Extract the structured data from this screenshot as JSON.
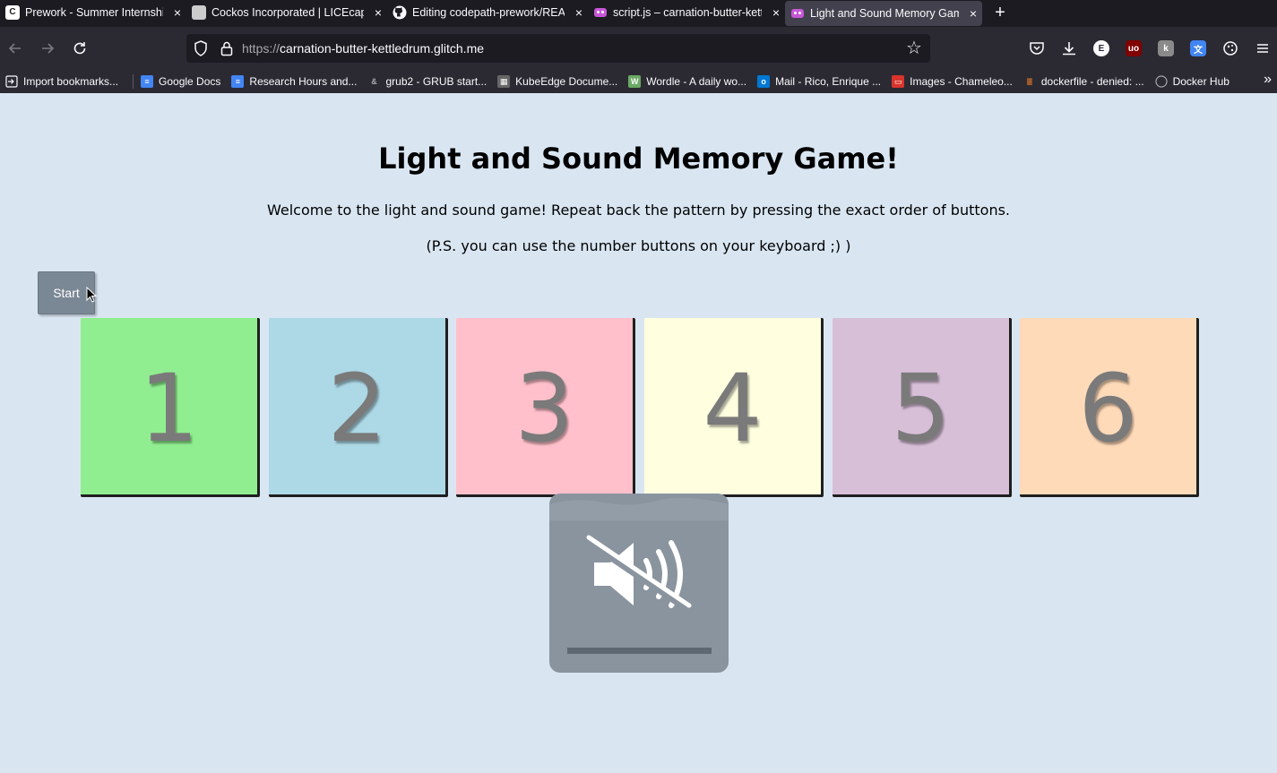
{
  "browser": {
    "tabs": [
      {
        "title": "Prework - Summer Internship for",
        "fav_color": "#ffffff",
        "fav_text": "C",
        "fav_fg": "#1c1b22"
      },
      {
        "title": "Cockos Incorporated | LICEcap",
        "fav_color": "#cccccc",
        "fav_text": "",
        "fav_fg": "#000000"
      },
      {
        "title": "Editing codepath-prework/READ",
        "fav_color": "#1c1b22",
        "fav_text": "",
        "fav_fg": "#ffffff"
      },
      {
        "title": "script.js – carnation-butter-kettl",
        "fav_color": "#c857d8",
        "fav_text": "",
        "fav_fg": "#ffffff"
      },
      {
        "title": "Light and Sound Memory Game!",
        "fav_color": "#c857d8",
        "fav_text": "",
        "fav_fg": "#ffffff"
      }
    ],
    "url_prefix": "https://",
    "url_host": "carnation-butter-kettledrum.glitch.me",
    "bookmarks": [
      {
        "label": "Import bookmarks...",
        "color": "#2b2a33"
      },
      {
        "label": "Google Docs",
        "color": "#4285f4"
      },
      {
        "label": "Research Hours and...",
        "color": "#4285f4"
      },
      {
        "label": "grub2 - GRUB start...",
        "color": "#2b2a33"
      },
      {
        "label": "KubeEdge Docume...",
        "color": "#666666"
      },
      {
        "label": "Wordle - A daily wo...",
        "color": "#6aaa64"
      },
      {
        "label": "Mail - Rico, Enrique ...",
        "color": "#0078d4"
      },
      {
        "label": "Images - Chameleo...",
        "color": "#d9342b"
      },
      {
        "label": "dockerfile - denied: ...",
        "color": "#f48024"
      },
      {
        "label": "Docker Hub",
        "color": "#2b2a33"
      }
    ]
  },
  "page": {
    "title": "Light and Sound Memory Game!",
    "intro": "Welcome to the light and sound game! Repeat back the pattern by pressing the exact order of buttons.",
    "hint": "(P.S. you can use the number buttons on your keyboard ;) )",
    "start_label": "Start",
    "buttons": [
      {
        "label": "1",
        "color": "#90ee90"
      },
      {
        "label": "2",
        "color": "#add8e6"
      },
      {
        "label": "3",
        "color": "#ffc0cb"
      },
      {
        "label": "4",
        "color": "#ffffe0"
      },
      {
        "label": "5",
        "color": "#d8bfd8"
      },
      {
        "label": "6",
        "color": "#ffdab9"
      }
    ],
    "mute_icon": "speaker-muted-icon"
  }
}
